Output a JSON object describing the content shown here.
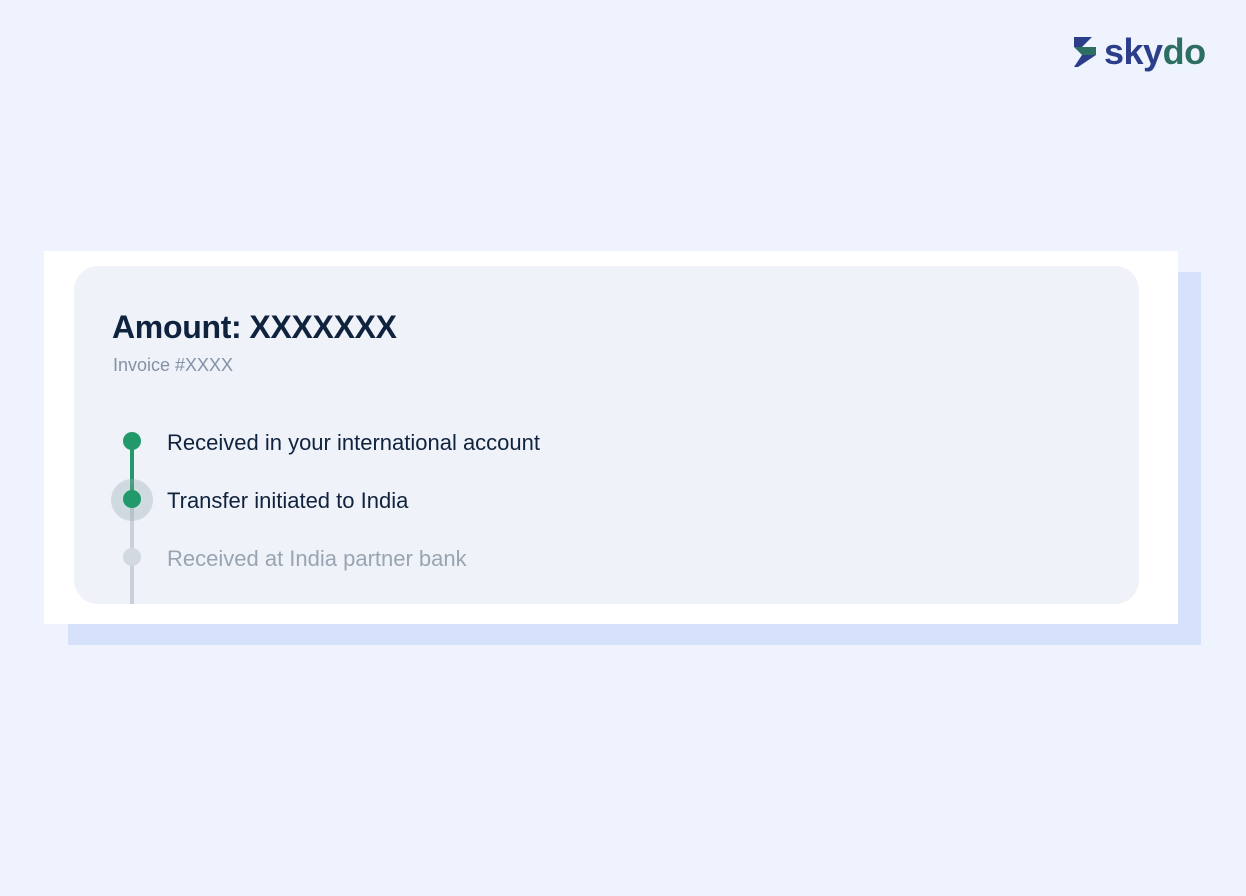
{
  "brand": {
    "logo_part1": "sky",
    "logo_part2": "do",
    "colors": {
      "primary": "#2c3e8a",
      "secondary": "#2c6e62"
    }
  },
  "card": {
    "amount_prefix": "Amount:",
    "amount_value": "XXXXXXX",
    "invoice": "Invoice #XXXX"
  },
  "timeline": {
    "steps": [
      {
        "label": "Received in your international account",
        "status": "complete"
      },
      {
        "label": "Transfer initiated to India",
        "status": "in-progress"
      },
      {
        "label": "Received at India partner bank",
        "status": "pending"
      }
    ],
    "colors": {
      "complete": "#22996a",
      "pending": "#c9d0da"
    }
  }
}
